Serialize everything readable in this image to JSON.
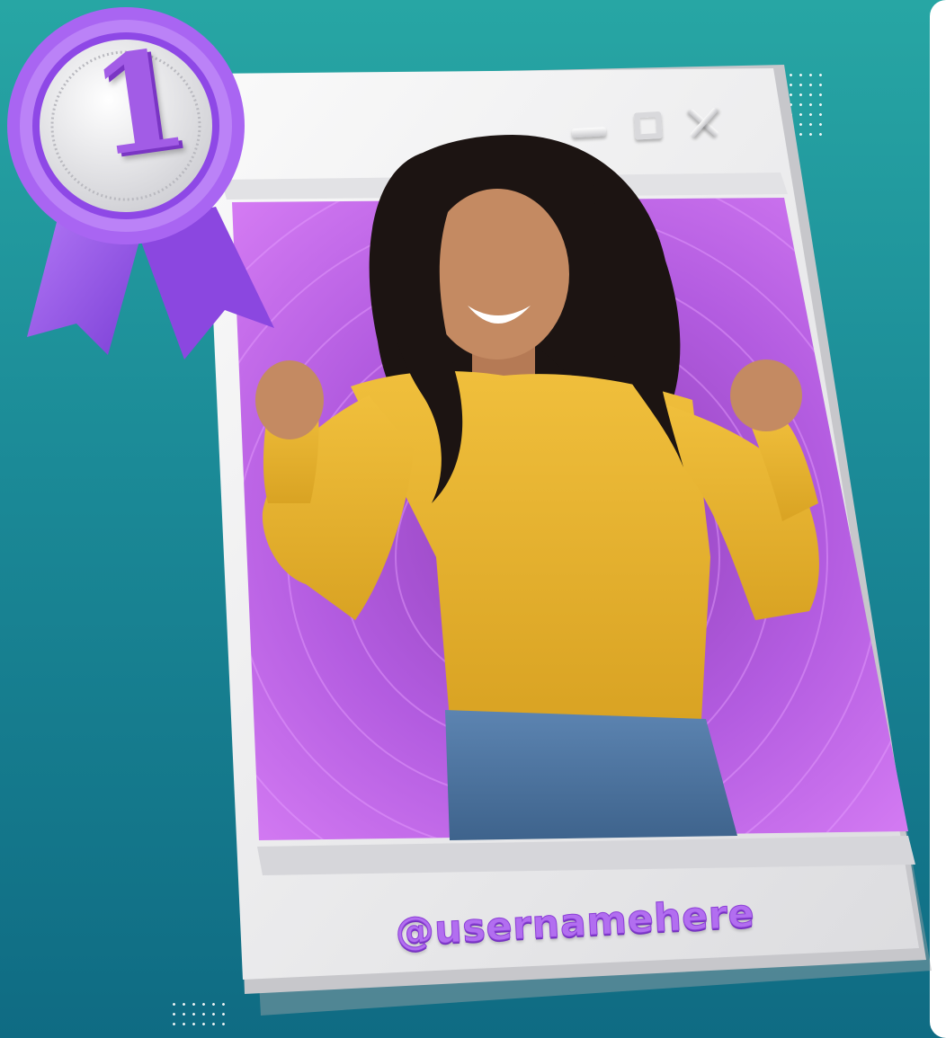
{
  "window": {
    "controls": {
      "minimize_icon": "minimize-icon",
      "maximize_icon": "maximize-icon",
      "close_icon": "close-icon"
    },
    "username": "@usernamehere"
  },
  "badge": {
    "number": "1",
    "icon": "award-ribbon-icon",
    "ribbon_color": "#9b55f0"
  },
  "photo": {
    "subject": "celebrating-person-photo",
    "backdrop_color": "#c86ef0"
  },
  "colors": {
    "background_top": "#27a6a4",
    "background_bottom": "#0f6b83",
    "frame": "#eeeeef",
    "accent": "#b26ef0"
  }
}
